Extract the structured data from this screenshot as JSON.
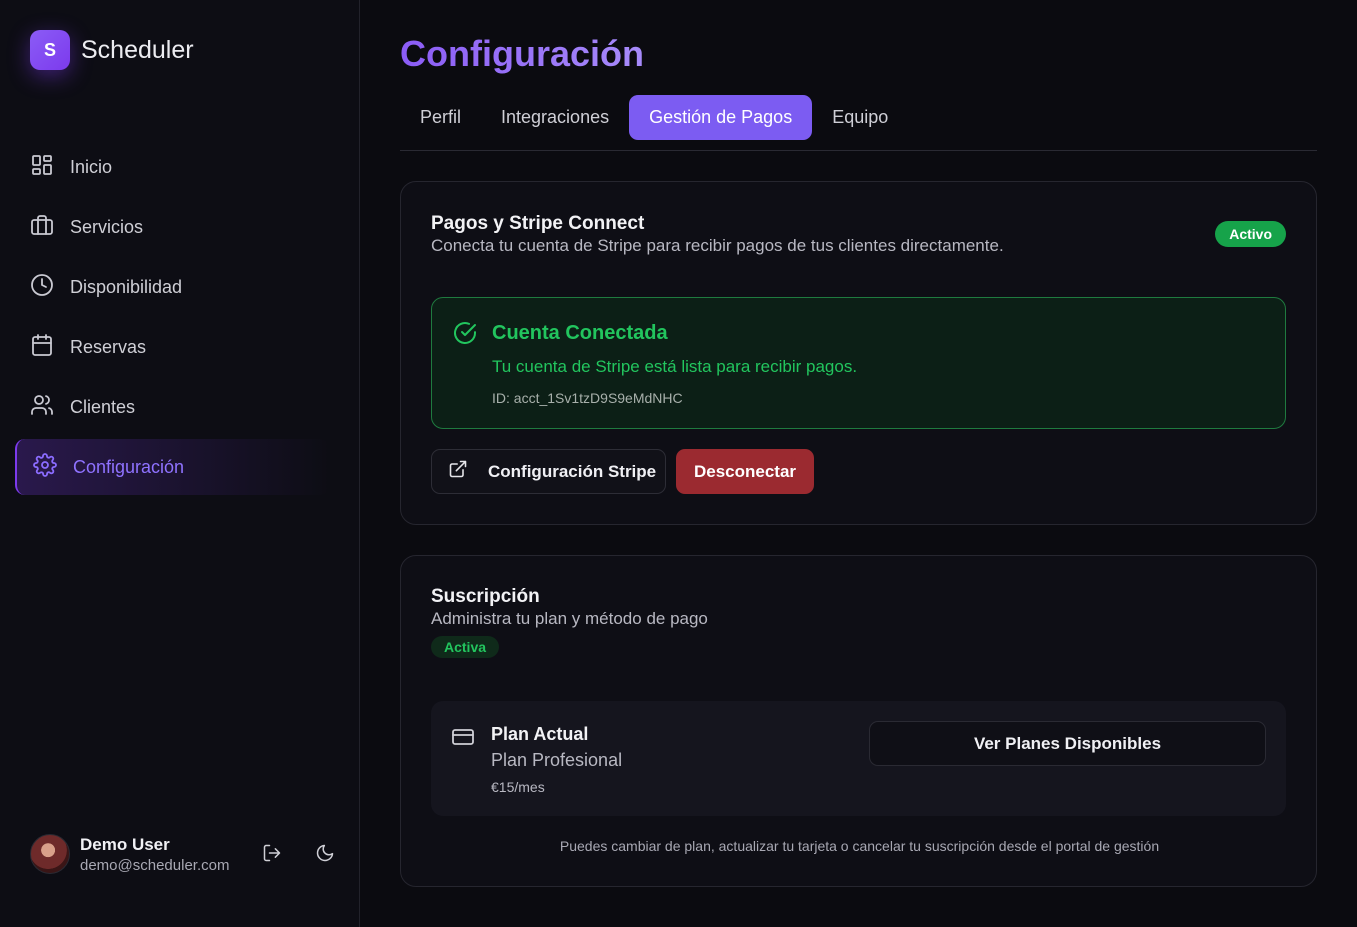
{
  "brand": {
    "logo_letter": "S",
    "name": "Scheduler"
  },
  "sidebar": {
    "items": [
      {
        "label": "Inicio",
        "icon": "grid-icon"
      },
      {
        "label": "Servicios",
        "icon": "briefcase-icon"
      },
      {
        "label": "Disponibilidad",
        "icon": "clock-icon"
      },
      {
        "label": "Reservas",
        "icon": "calendar-icon"
      },
      {
        "label": "Clientes",
        "icon": "users-icon"
      },
      {
        "label": "Configuración",
        "icon": "gear-icon",
        "active": true
      }
    ]
  },
  "user": {
    "name": "Demo User",
    "email": "demo@scheduler.com"
  },
  "page": {
    "title": "Configuración"
  },
  "tabs": [
    {
      "label": "Perfil"
    },
    {
      "label": "Integraciones"
    },
    {
      "label": "Gestión de Pagos",
      "active": true
    },
    {
      "label": "Equipo"
    }
  ],
  "payments": {
    "title": "Pagos y Stripe Connect",
    "subtitle": "Conecta tu cuenta de Stripe para recibir pagos de tus clientes directamente.",
    "status": "Activo",
    "connected": {
      "title": "Cuenta Conectada",
      "description": "Tu cuenta de Stripe está lista para recibir pagos.",
      "account_id": "ID: acct_1Sv1tzD9S9eMdNHC"
    },
    "config_button": "Configuración Stripe",
    "disconnect_button": "Desconectar"
  },
  "subscription": {
    "title": "Suscripción",
    "subtitle": "Administra tu plan y método de pago",
    "status": "Activa",
    "plan_label": "Plan Actual",
    "plan_name": "Plan Profesional",
    "plan_price": "€15/mes",
    "plans_button": "Ver Planes Disponibles",
    "footnote": "Puedes cambiar de plan, actualizar tu tarjeta o cancelar tu suscripción desde el portal de gestión"
  },
  "colors": {
    "accent": "#7c5cf2",
    "success": "#22c55e",
    "danger": "#9b2a30",
    "background": "#0b0b10"
  }
}
